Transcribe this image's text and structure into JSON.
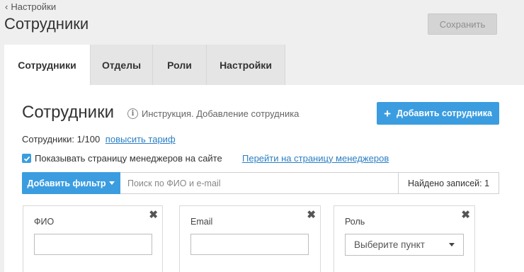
{
  "header": {
    "back_label": "Настройки",
    "title": "Сотрудники",
    "save_label": "Сохранить"
  },
  "tabs": [
    {
      "label": "Сотрудники",
      "active": true
    },
    {
      "label": "Отделы",
      "active": false
    },
    {
      "label": "Роли",
      "active": false
    },
    {
      "label": "Настройки",
      "active": false
    }
  ],
  "main": {
    "title": "Сотрудники",
    "info_link": "Инструкция. Добавление сотрудника",
    "add_button": "Добавить сотрудника",
    "count_text": "Сотрудники: 1/100",
    "upgrade_link": "повысить тариф",
    "show_managers_label": "Показывать страницу менеджеров на сайте",
    "show_managers_checked": true,
    "managers_link": "Перейти на страницу менеджеров",
    "filter_button": "Добавить фильтр",
    "search_placeholder": "Поиск по ФИО и e-mail",
    "found_text": "Найдено записей: 1",
    "filters": {
      "fio": {
        "label": "ФИО",
        "value": ""
      },
      "email": {
        "label": "Email",
        "value": ""
      },
      "role": {
        "label": "Роль",
        "selected": "Выберите пункт"
      }
    }
  },
  "colors": {
    "accent": "#3b9de0",
    "link": "#2a7fc4",
    "background": "#efefef",
    "save_disabled": "#d4d4d4"
  }
}
